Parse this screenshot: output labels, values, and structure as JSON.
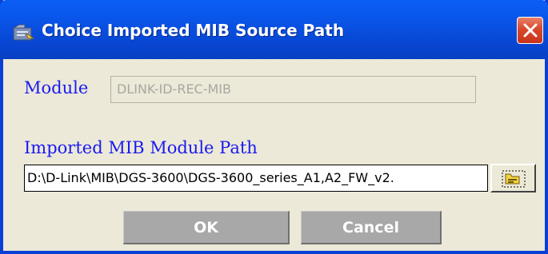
{
  "window": {
    "title": "Choice Imported MIB Source Path",
    "close_icon": "close-icon",
    "app_icon": "mib-folder-icon"
  },
  "form": {
    "module_label": "Module",
    "module_value": "DLINK-ID-REC-MIB",
    "path_label": "Imported MIB Module Path",
    "path_value": "D:\\D-Link\\MIB\\DGS-3600\\DGS-3600_series_A1,A2_FW_v2.",
    "browse_icon": "browse-folder-icon"
  },
  "buttons": {
    "ok_label": "OK",
    "cancel_label": "Cancel"
  },
  "colors": {
    "titlebar": "#0a56ea",
    "label_text": "#1a1af0",
    "close_button": "#d8482a",
    "dialog_background": "#ece9d8",
    "button_face": "#a8a8a8"
  }
}
